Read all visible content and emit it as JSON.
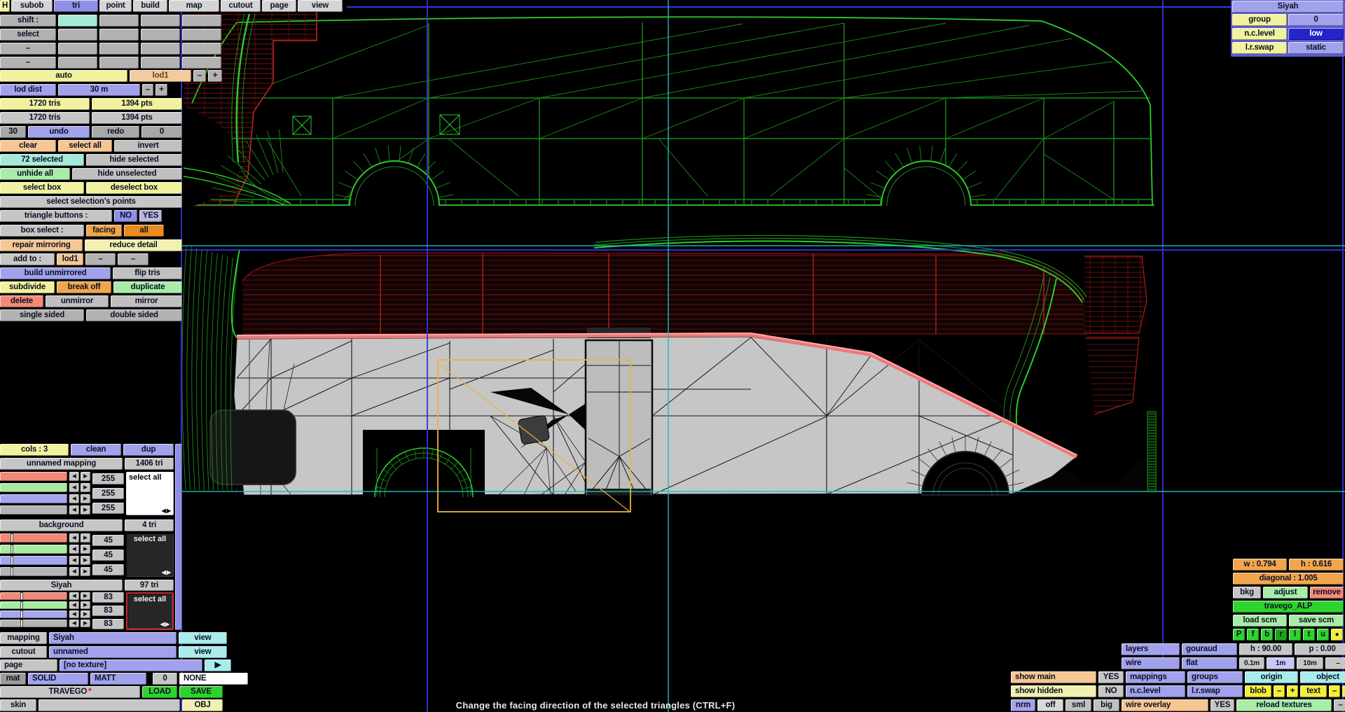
{
  "menu": {
    "items": [
      "H",
      "subob",
      "tri",
      "point",
      "build",
      "map",
      "cutout",
      "page",
      "view"
    ],
    "active": "tri"
  },
  "tools": {
    "shift": "shift :",
    "select": "select",
    "dash": "–",
    "auto": "auto",
    "lod1": "lod1",
    "minus": "–",
    "plus": "+",
    "lod_dist": "lod dist",
    "lod_dist_value": "30 m",
    "sel_tris": "1720 tris",
    "sel_pts": "1394 pts",
    "tot_tris": "1720 tris",
    "tot_pts": "1394 pts",
    "undo_count": "30",
    "undo": "undo",
    "redo": "redo",
    "redo_count": "0",
    "clear": "clear",
    "select_all": "select all",
    "invert": "invert",
    "selected_count": "72 selected",
    "hide_selected": "hide selected",
    "unhide_all": "unhide all",
    "hide_unselected": "hide unselected",
    "select_box": "select box",
    "deselect_box": "deselect box",
    "select_sel_points": "select selection's points",
    "triangle_buttons": "triangle buttons :",
    "no": "NO",
    "yes": "YES",
    "box_select": "box select :",
    "facing": "facing",
    "all": "all",
    "repair_mirroring": "repair mirroring",
    "reduce_detail": "reduce detail",
    "add_to": "add to :",
    "add_lod1": "lod1",
    "build_unmirrored": "build unmirrored",
    "flip_tris": "flip tris",
    "subdivide": "subdivide",
    "break_off": "break off",
    "duplicate": "duplicate",
    "delete": "delete",
    "unmirror": "unmirror",
    "mirror": "mirror",
    "single_sided": "single sided",
    "double_sided": "double sided"
  },
  "materials": {
    "cols": "cols : 3",
    "clean": "clean",
    "dup": "dup",
    "select_all": "select all",
    "groups": [
      {
        "name": "unnamed mapping",
        "tris": "1406 tri",
        "r": "255",
        "g": "255",
        "b": "255"
      },
      {
        "name": "background",
        "tris": "4 tri",
        "r": "45",
        "g": "45",
        "b": "45"
      },
      {
        "name": "Siyah",
        "tris": "97 tri",
        "r": "83",
        "g": "83",
        "b": "83"
      }
    ]
  },
  "bottom_left": {
    "mapping": "mapping",
    "mapping_value": "Siyah",
    "view": "view",
    "cutout": "cutout",
    "cutout_value": "unnamed",
    "page": "page",
    "page_value": "[no texture]",
    "page_next": "▶",
    "mat": "mat",
    "solid": "SOLID",
    "matt": "MATT",
    "mat_count": "0",
    "none": "NONE",
    "model": "TRAVEGO",
    "model_mark": "*",
    "load": "LOAD",
    "save": "SAVE",
    "skin": "skin",
    "obj": "OBJ"
  },
  "object_panel": {
    "title": "Siyah",
    "group": "group",
    "group_value": "0",
    "nc_level": "n.c.level",
    "nc_value": "low",
    "lr_swap": "l.r.swap",
    "lr_value": "static"
  },
  "texture_panel": {
    "w": "w : 0.794",
    "h": "h : 0.616",
    "diagonal": "diagonal : 1.005",
    "bkg": "bkg",
    "adjust": "adjust",
    "remove": "remove",
    "texture": "travego_ALP",
    "load_scm": "load scm",
    "save_scm": "save scm",
    "proj": [
      "P",
      "f",
      "b",
      "r",
      "l",
      "t",
      "u",
      "●"
    ]
  },
  "view_panel": {
    "layers": "layers",
    "gouraud": "gouraud",
    "heading": "h : 90.00",
    "pitch": "p : 0.00",
    "wire": "wire",
    "flat": "flat",
    "grid": [
      "0.1m",
      "1m",
      "10m",
      "–"
    ],
    "show_main": "show main",
    "show_main_value": "YES",
    "mappings": "mappings",
    "groups": "groups",
    "origin": "origin",
    "object": "object",
    "show_hidden": "show hidden",
    "show_hidden_value": "NO",
    "nc_level": "n.c.level",
    "lr_swap": "l.r.swap",
    "blob": "blob",
    "text": "text",
    "minus": "–",
    "plus": "+",
    "nrm": "nrm",
    "off": "off",
    "sml": "sml",
    "big": "big",
    "wire_overlay": "wire overlay",
    "wire_overlay_value": "YES",
    "reload_textures": "reload textures",
    "dash": "–"
  },
  "status": {
    "message": "Change the facing direction of the selected triangles (CTRL+F)"
  },
  "arrows": {
    "left": "◀",
    "right": "▶"
  },
  "colors": {
    "wire_green": "#1fa51f",
    "wire_green_bright": "#2acc2a",
    "hidden_red": "#7c1212",
    "selected_edge_pink": "#f07878",
    "grid_blue": "#3434e0",
    "grid_cyan": "#17bdbd",
    "selection_box_orange": "#edb13c",
    "highlight_navy": "#2424cc"
  }
}
